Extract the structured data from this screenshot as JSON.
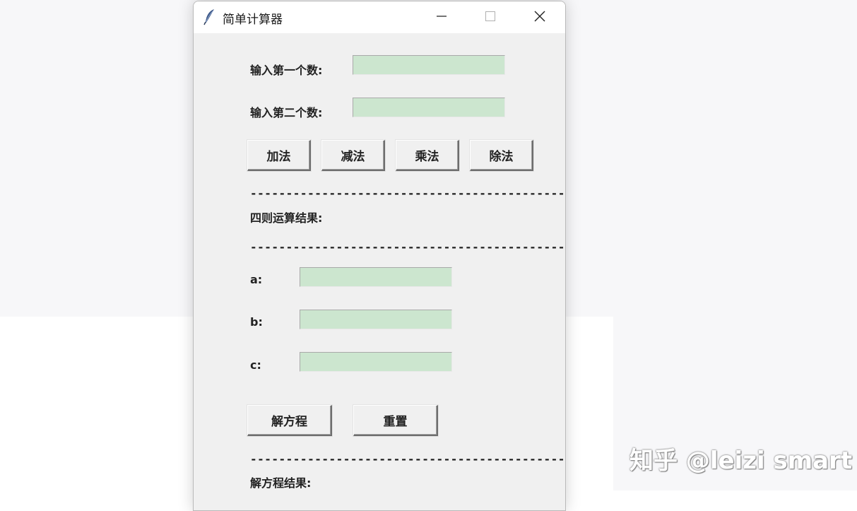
{
  "window": {
    "title": "简单计算器"
  },
  "inputs": {
    "first_label": "输入第一个数:",
    "first_value": "",
    "second_label": "输入第二个数:",
    "second_value": ""
  },
  "ops": {
    "add": "加法",
    "sub": "减法",
    "mul": "乘法",
    "div": "除法"
  },
  "separator": "------------------------------------------------",
  "arith_result_label": "四则运算结果:",
  "coeffs": {
    "a_label": "a:",
    "a_value": "",
    "b_label": "b:",
    "b_value": "",
    "c_label": "c:",
    "c_value": ""
  },
  "actions": {
    "solve": "解方程",
    "reset": "重置"
  },
  "solve_result_label": "解方程结果:",
  "watermark": "知乎 @leizi smart",
  "icons": {
    "app": "feather-icon",
    "minimize": "minimize-icon",
    "maximize": "maximize-icon",
    "close": "close-icon"
  },
  "colors": {
    "entry_bg": "#cce6cf",
    "window_bg": "#f0f0f0"
  }
}
